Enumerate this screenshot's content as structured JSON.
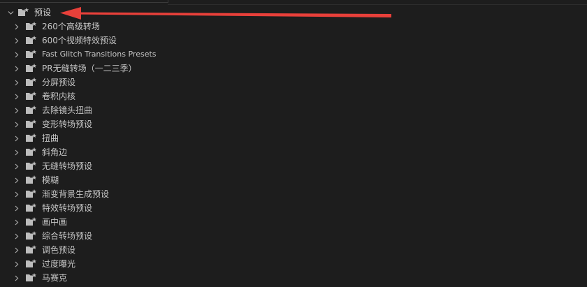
{
  "tree": {
    "root": {
      "label": "预设",
      "expanded": true,
      "icon": "preset-folder-icon"
    },
    "children": [
      {
        "label": "260个高级转场"
      },
      {
        "label": "600个视频特效预设"
      },
      {
        "label": "Fast Glitch Transitions Presets"
      },
      {
        "label": "PR无缝转场（一二三季）"
      },
      {
        "label": "分屏预设"
      },
      {
        "label": "卷积内核"
      },
      {
        "label": "去除镜头扭曲"
      },
      {
        "label": "变形转场预设"
      },
      {
        "label": "扭曲"
      },
      {
        "label": "斜角边"
      },
      {
        "label": "无缝转场预设"
      },
      {
        "label": "模糊"
      },
      {
        "label": "渐变背景生成预设"
      },
      {
        "label": "特效转场预设"
      },
      {
        "label": "画中画"
      },
      {
        "label": "综合转场预设"
      },
      {
        "label": "调色预设"
      },
      {
        "label": "过度曝光"
      },
      {
        "label": "马赛克"
      }
    ]
  },
  "colors": {
    "background": "#1d1d1d",
    "text": "#c6c6c6",
    "folder": "#bdbdbd",
    "annotation_arrow": "#e8403a"
  },
  "annotation": {
    "type": "arrow",
    "points_to": "tree.root"
  }
}
